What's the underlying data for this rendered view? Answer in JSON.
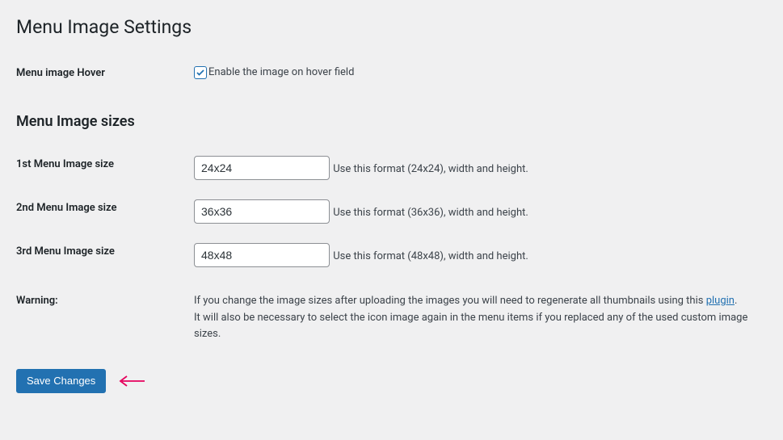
{
  "page": {
    "title": "Menu Image Settings"
  },
  "hover": {
    "label": "Menu image Hover",
    "checkbox_label": "Enable the image on hover field",
    "checked": true
  },
  "sizes": {
    "heading": "Menu Image sizes",
    "rows": [
      {
        "label": "1st Menu Image size",
        "value": "24x24",
        "hint": "Use this format (24x24), width and height."
      },
      {
        "label": "2nd Menu Image size",
        "value": "36x36",
        "hint": "Use this format (36x36), width and height."
      },
      {
        "label": "3rd Menu Image size",
        "value": "48x48",
        "hint": "Use this format (48x48), width and height."
      }
    ]
  },
  "warning": {
    "label": "Warning:",
    "line1_pre": "If you change the image sizes after uploading the images you will need to regenerate all thumbnails using this ",
    "link_text": "plugin",
    "line1_post": ".",
    "line2": "It will also be necessary to select the icon image again in the menu items if you replaced any of the used custom image sizes."
  },
  "submit": {
    "label": "Save Changes"
  }
}
